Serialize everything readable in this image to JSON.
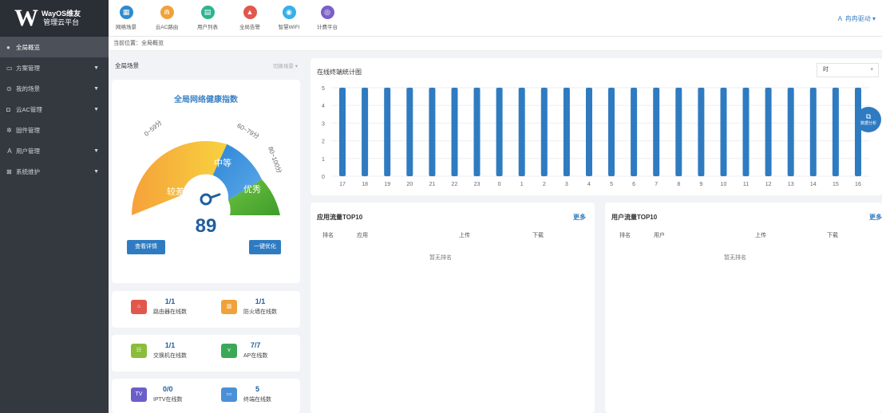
{
  "brand": {
    "logo_letter": "W",
    "line1": "WayOS维友",
    "line2": "管理云平台"
  },
  "sidebar": {
    "items": [
      {
        "label": "全局概览",
        "icon": "circle-icon"
      },
      {
        "label": "方案管理",
        "icon": "briefcase-icon"
      },
      {
        "label": "我的场景",
        "icon": "scene-icon"
      },
      {
        "label": "云AC管理",
        "icon": "ac-icon"
      },
      {
        "label": "固件管理",
        "icon": "gear-icon"
      },
      {
        "label": "用户管理",
        "icon": "user-icon"
      },
      {
        "label": "系统维护",
        "icon": "tools-icon"
      }
    ]
  },
  "topnav": {
    "items": [
      {
        "label": "网络场景",
        "color": "#2e8bcf",
        "icon": "grid-icon"
      },
      {
        "label": "云AC路由",
        "color": "#f0a23a",
        "icon": "router-icon"
      },
      {
        "label": "用户列表",
        "color": "#2bb58f",
        "icon": "list-icon"
      },
      {
        "label": "全局告警",
        "color": "#e2574c",
        "icon": "alert-icon"
      },
      {
        "label": "智慧WIFI",
        "color": "#36b0e8",
        "icon": "wifi-icon"
      },
      {
        "label": "计费平台",
        "color": "#7b5fc9",
        "icon": "billing-icon"
      }
    ],
    "user": "冉冉驱动"
  },
  "breadcrumb": "当前位置：全局概览",
  "scene": {
    "label": "全局场景",
    "switch": "切换场景"
  },
  "health": {
    "title": "全局网络健康指数",
    "ranges": [
      "0~59分",
      "60~79分",
      "80~100分"
    ],
    "levels": [
      "较差",
      "中等",
      "优秀"
    ],
    "score": "89",
    "score_value": 89,
    "detail_btn": "查看详情",
    "optimize_btn": "一键优化"
  },
  "stats": [
    {
      "value": "1/1",
      "name": "路由器在线数",
      "icon": "router-icon",
      "color": "#e2574c"
    },
    {
      "value": "1/1",
      "name": "防火墙在线数",
      "icon": "firewall-icon",
      "color": "#f0a23a"
    },
    {
      "value": "1/1",
      "name": "交换机在线数",
      "icon": "switch-icon",
      "color": "#8bbd3c"
    },
    {
      "value": "7/7",
      "name": "AP在线数",
      "icon": "ap-icon",
      "color": "#3aa957"
    },
    {
      "value": "0/0",
      "name": "IPTV在线数",
      "icon": "iptv-icon",
      "color": "#6a5fc9"
    },
    {
      "value": "5",
      "name": "终端在线数",
      "icon": "terminal-icon",
      "color": "#4a90d9"
    }
  ],
  "chart": {
    "title": "在线终端统计图",
    "period": "时"
  },
  "chart_data": {
    "type": "bar",
    "title": "在线终端统计图",
    "categories": [
      "17",
      "18",
      "19",
      "20",
      "21",
      "22",
      "23",
      "0",
      "1",
      "2",
      "3",
      "4",
      "5",
      "6",
      "7",
      "8",
      "9",
      "10",
      "11",
      "12",
      "13",
      "14",
      "15",
      "16"
    ],
    "values": [
      5,
      5,
      5,
      5,
      5,
      5,
      5,
      5,
      5,
      5,
      5,
      5,
      5,
      5,
      5,
      5,
      5,
      5,
      5,
      5,
      5,
      5,
      5,
      5
    ],
    "yticks": [
      "0",
      "1",
      "2",
      "3",
      "4",
      "5"
    ],
    "ylim": [
      0,
      5
    ],
    "color": "#2f7bc1"
  },
  "float_button": "数据分析",
  "app_top": {
    "title": "应用流量TOP10",
    "more": "更多",
    "cols": [
      "排名",
      "应用",
      "上传",
      "下载"
    ],
    "empty": "暂无排名"
  },
  "user_top": {
    "title": "用户流量TOP10",
    "more": "更多",
    "cols": [
      "排名",
      "用户",
      "上传",
      "下载"
    ],
    "empty": "暂无排名"
  }
}
